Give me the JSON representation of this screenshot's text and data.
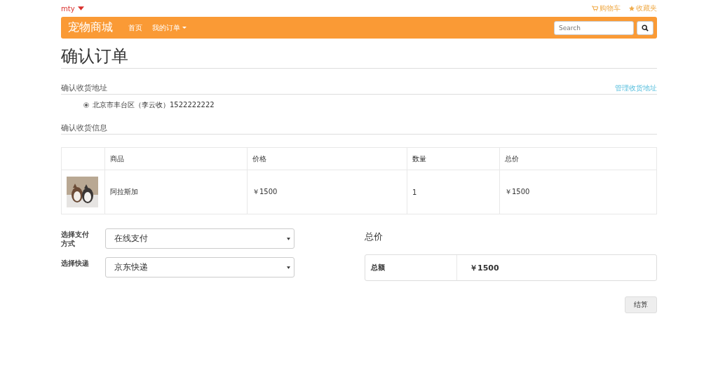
{
  "topbar": {
    "user": "mty",
    "links": [
      {
        "kind": "cart",
        "label": "购物车"
      },
      {
        "kind": "star",
        "label": "收藏夹"
      }
    ]
  },
  "navbar": {
    "brand": "宠物商城",
    "items": [
      {
        "label": "首页",
        "dropdown": false
      },
      {
        "label": "我的订单",
        "dropdown": true
      }
    ],
    "search": {
      "placeholder": "Search"
    }
  },
  "page_title": "确认订单",
  "address_section": {
    "title": "确认收货地址",
    "manage_link": "管理收货地址",
    "addresses": [
      {
        "text": "北京市丰台区（李云收）1522222222",
        "selected": true
      }
    ]
  },
  "goods_section": {
    "title": "确认收货信息",
    "table": {
      "columns": [
        "商品",
        "价格",
        "数量",
        "总价"
      ],
      "rows": [
        {
          "name": "阿拉斯加",
          "price": "￥1500",
          "quantity": "1",
          "total": "￥1500"
        }
      ]
    }
  },
  "options": [
    {
      "label": "选择支付方式",
      "value": "在线支付"
    },
    {
      "label": "选择快递",
      "value": "京东快递"
    }
  ],
  "summary": {
    "title": "总价",
    "label": "总额",
    "amount": "￥1500"
  },
  "checkout_button": "结算"
}
